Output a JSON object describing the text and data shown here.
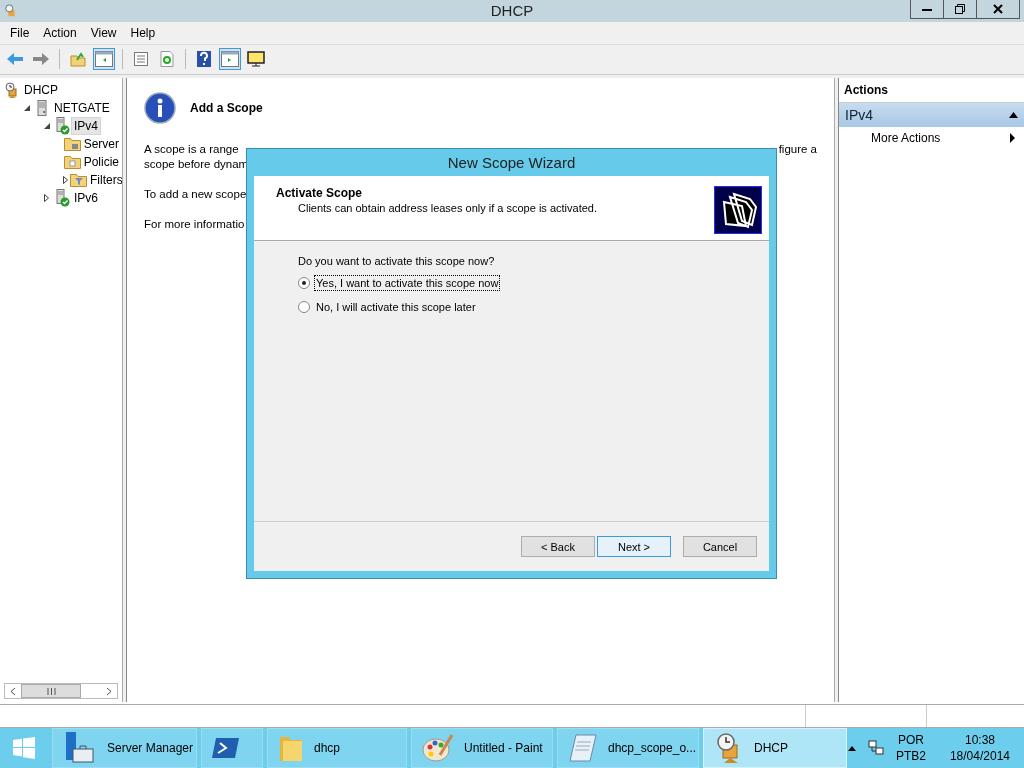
{
  "window": {
    "title": "DHCP"
  },
  "menu": [
    "File",
    "Action",
    "View",
    "Help"
  ],
  "toolbar": [
    {
      "kind": "back",
      "pressed": false
    },
    {
      "kind": "forward",
      "pressed": false
    },
    {
      "kind": "sep"
    },
    {
      "kind": "up",
      "pressed": false
    },
    {
      "kind": "tree-toggle",
      "pressed": true
    },
    {
      "kind": "sep"
    },
    {
      "kind": "export",
      "pressed": false
    },
    {
      "kind": "refresh",
      "pressed": false
    },
    {
      "kind": "sep"
    },
    {
      "kind": "help",
      "pressed": false
    },
    {
      "kind": "action-toggle",
      "pressed": true
    },
    {
      "kind": "monitor",
      "pressed": false
    }
  ],
  "tree": [
    {
      "label": "DHCP",
      "kind": "root",
      "selected": false,
      "children": [
        {
          "label": "NETGATE",
          "kind": "server",
          "expanded": true,
          "selected": false,
          "children": [
            {
              "label": "IPv4",
              "kind": "protocol",
              "expanded": true,
              "selected": true,
              "children": [
                {
                  "label": "Server",
                  "kind": "folder",
                  "selected": false
                },
                {
                  "label": "Policie",
                  "kind": "policy",
                  "selected": false
                },
                {
                  "label": "Filters",
                  "kind": "filter",
                  "expanded": false,
                  "selected": false
                }
              ]
            },
            {
              "label": "IPv6",
              "kind": "protocol",
              "expanded": false,
              "selected": false
            }
          ]
        }
      ]
    }
  ],
  "content": {
    "heading": "Add a Scope",
    "lines": [
      {
        "left": "A scope is a range",
        "right": "figure a"
      },
      {
        "left": "scope before dynam"
      },
      {
        "left": "To add a new scope"
      },
      {
        "left": "For more informatio"
      }
    ]
  },
  "actions": {
    "title": "Actions",
    "group": {
      "label": "IPv4",
      "expanded": true
    },
    "items": [
      {
        "label": "More Actions"
      }
    ]
  },
  "dialog": {
    "title": "New Scope Wizard",
    "header_title": "Activate Scope",
    "header_subtitle": "Clients can obtain address leases only if a scope is activated.",
    "question": "Do you want to activate this scope now?",
    "options": [
      {
        "label": "Yes, I want to activate this scope now",
        "selected": true,
        "focused": true
      },
      {
        "label": "No, I will activate this scope later",
        "selected": false,
        "focused": false
      }
    ],
    "buttons": [
      {
        "label": "< Back",
        "default": false
      },
      {
        "label": "Next >",
        "default": true
      },
      {
        "label": "Cancel",
        "default": false
      }
    ]
  },
  "taskbar": {
    "items": [
      {
        "label": "Server Manager",
        "kind": "server-manager",
        "active": false
      },
      {
        "kind": "powershell",
        "active": false
      },
      {
        "label": "dhcp",
        "kind": "folder",
        "active": false
      },
      {
        "label": "Untitled - Paint",
        "kind": "paint",
        "active": false
      },
      {
        "label": "dhcp_scope_o...",
        "kind": "notepad",
        "active": false
      },
      {
        "label": "DHCP",
        "kind": "dhcp",
        "active": true
      }
    ],
    "tray": {
      "language": "POR",
      "layout": "PTB2",
      "time": "10:38",
      "date": "18/04/2014"
    }
  }
}
